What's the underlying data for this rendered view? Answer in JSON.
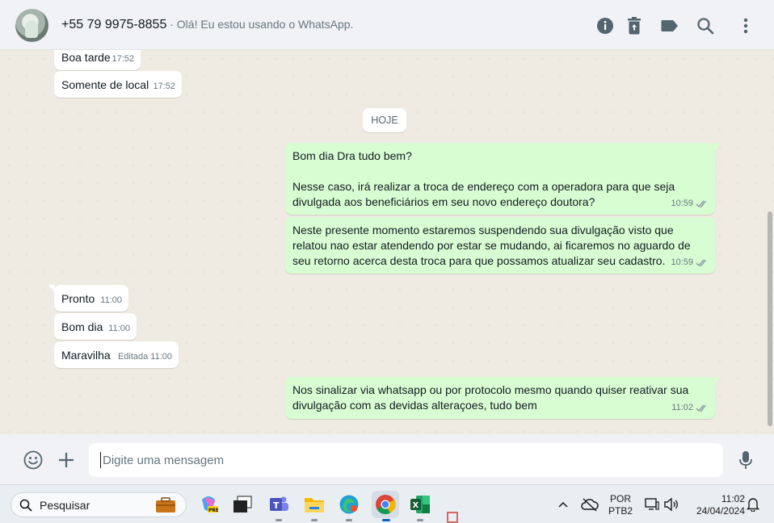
{
  "header": {
    "contact_name": "+55 79 9975-8855",
    "status_text": " · Olá! Eu estou usando o WhatsApp.",
    "icons": [
      "info-icon",
      "trash-icon",
      "label-icon",
      "search-icon",
      "menu-icon"
    ]
  },
  "date_separator": "HOJE",
  "messages": [
    {
      "dir": "in",
      "text": "Boa tarde",
      "time": "17:52"
    },
    {
      "dir": "in",
      "text": "Somente de local",
      "time": "17:52"
    },
    {
      "dir": "out",
      "text_line1": "Bom dia Dra tudo bem?",
      "text_line2": "Nesse caso, irá realizar a troca de endereço com a operadora para que seja",
      "text_line3": "divulgada aos beneficiários em seu novo endereço doutora?",
      "time": "10:59"
    },
    {
      "dir": "out",
      "text_line1": "Neste presente momento estaremos suspendendo sua divulgação visto que",
      "text_line2": "relatou nao estar atendendo por estar se mudando, ai ficaremos no aguardo de",
      "text_line3": "seu retorno acerca desta troca para que possamos atualizar seu cadastro.",
      "time": "10:59"
    },
    {
      "dir": "in",
      "text": "Pronto",
      "time": "11:00"
    },
    {
      "dir": "in",
      "text": "Bom dia",
      "time": "11:00"
    },
    {
      "dir": "in",
      "text": "Maravilha",
      "edited": "Editada",
      "time": "11:00"
    },
    {
      "dir": "out",
      "text_line1": "Nos sinalizar via whatsapp ou por protocolo mesmo quando quiser reativar sua",
      "text_line2": "divulgação com as devidas alteraçoes, tudo bem",
      "time": "11:02"
    }
  ],
  "compose": {
    "placeholder": "Digite uma mensagem"
  },
  "taskbar": {
    "search_label": "Pesquisar",
    "lang_top": "POR",
    "lang_bottom": "PTB2",
    "time": "11:02",
    "date": "24/04/2024"
  },
  "colors": {
    "incoming_bubble": "#ffffff",
    "outgoing_bubble": "#d9fdd3",
    "chat_background": "#efeae2",
    "header_background": "#f0f2f5"
  }
}
